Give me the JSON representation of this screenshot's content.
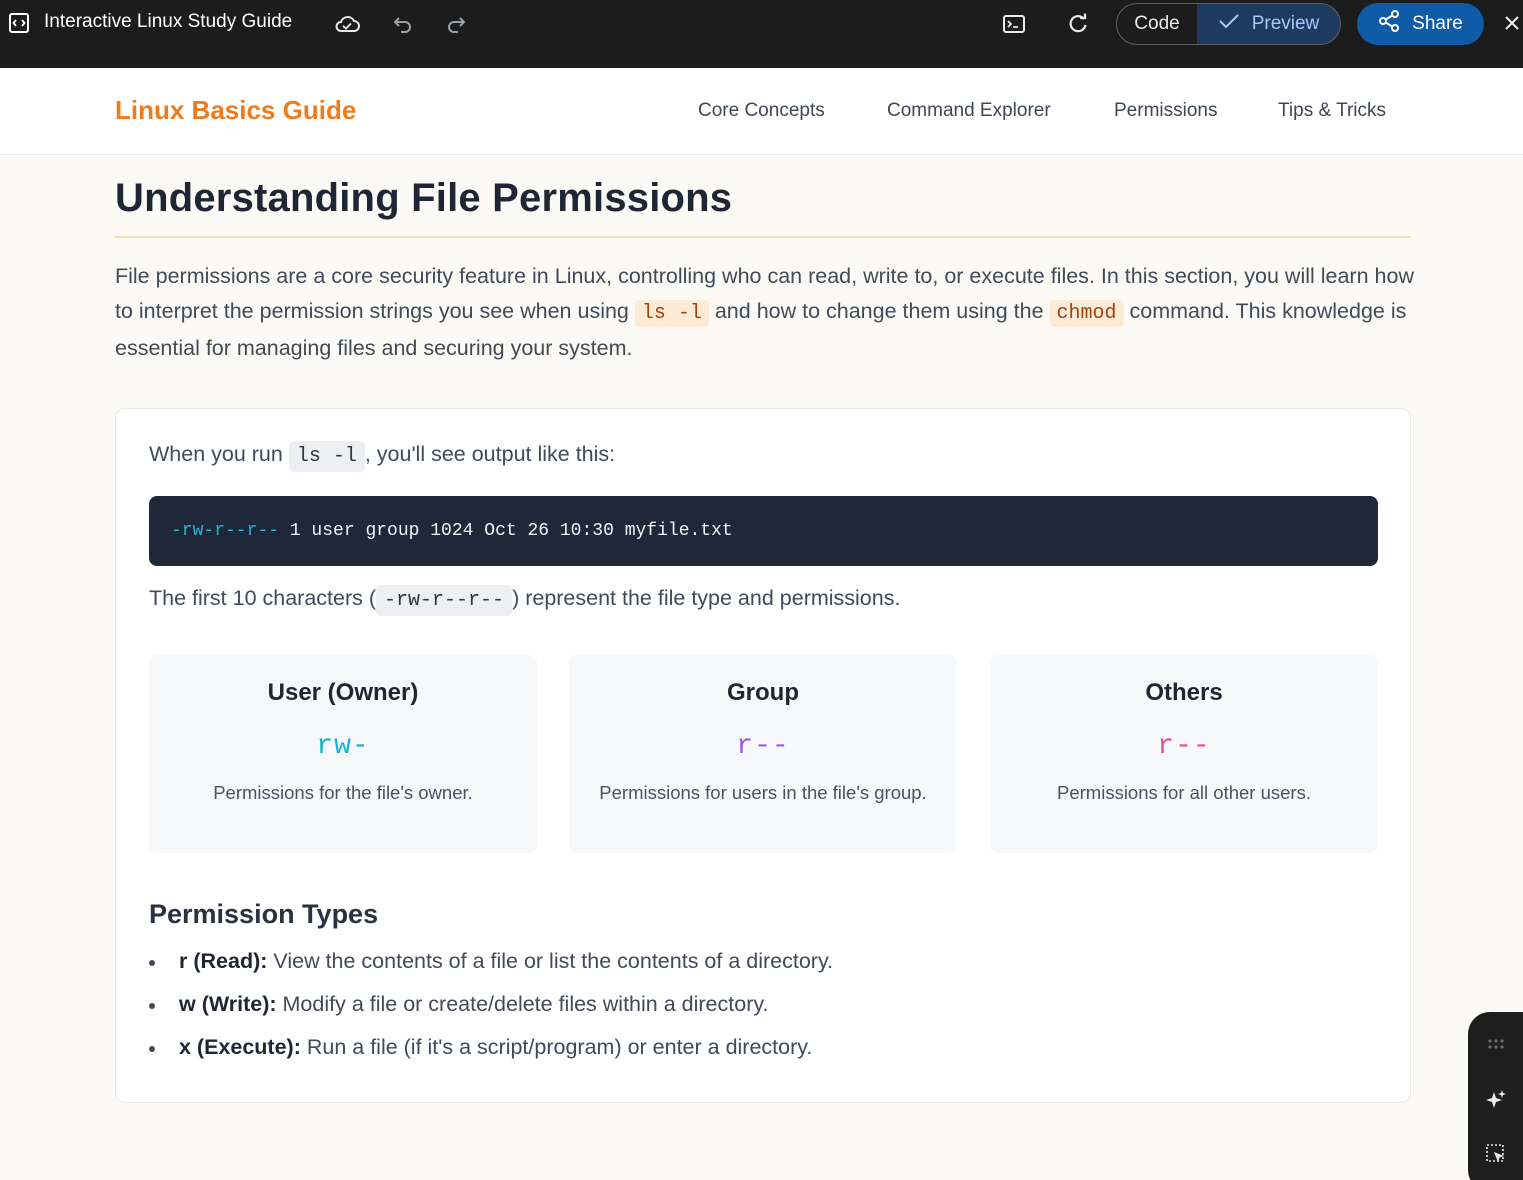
{
  "appbar": {
    "title": "Interactive Linux Study Guide",
    "code_label": "Code",
    "preview_label": "Preview",
    "share_label": "Share",
    "icons": [
      "app-embed-icon",
      "cloud-icon",
      "undo-icon",
      "redo-icon",
      "terminal-icon",
      "refresh-icon",
      "check-icon",
      "share-icon",
      "close-icon"
    ]
  },
  "site": {
    "brand": "Linux Basics Guide",
    "nav": [
      "Core Concepts",
      "Command Explorer",
      "Permissions",
      "Tips & Tricks"
    ],
    "brand_color": "#f07b1d"
  },
  "main": {
    "title": "Understanding File Permissions",
    "intro_part1": "File permissions are a core security feature in Linux, controlling who can read, write to, or execute files. In this section, you will learn how to interpret the permission strings you see when using ",
    "intro_code1": "ls -l",
    "intro_part2": " and how to change them using the ",
    "intro_code2": "chmod",
    "intro_part3": " command. This knowledge is essential for managing files and securing your system."
  },
  "card": {
    "when_prefix": "When you run ",
    "when_code": "ls -l",
    "when_suffix": ", you'll see output like this:",
    "terminal_perm": "-rw-r--r--",
    "terminal_rest": " 1 user group 1024 Oct 26 10:30 myfile.txt",
    "first10_prefix": "The first 10 characters (",
    "first10_code": "-rw-r--r--",
    "first10_suffix": ") represent the file type and permissions.",
    "boxes": [
      {
        "title": "User (Owner)",
        "perm": "rw-",
        "desc": "Permissions for the file's owner.",
        "color": "#19b3cc"
      },
      {
        "title": "Group",
        "perm": "r--",
        "desc": "Permissions for users in the file's group.",
        "color": "#9b59f0"
      },
      {
        "title": "Others",
        "perm": "r--",
        "desc": "Permissions for all other users.",
        "color": "#df4fa8"
      }
    ],
    "types_title": "Permission Types",
    "types": [
      {
        "term": "r (Read):",
        "desc": " View the contents of a file or list the contents of a directory."
      },
      {
        "term": "w (Write):",
        "desc": " Modify a file or create/delete files within a directory."
      },
      {
        "term": "x (Execute):",
        "desc": " Run a file (if it's a script/program) or enter a directory."
      }
    ]
  },
  "widget": {
    "icons": [
      "drag-handle-icon",
      "sparkle-icon",
      "select-element-icon"
    ]
  }
}
